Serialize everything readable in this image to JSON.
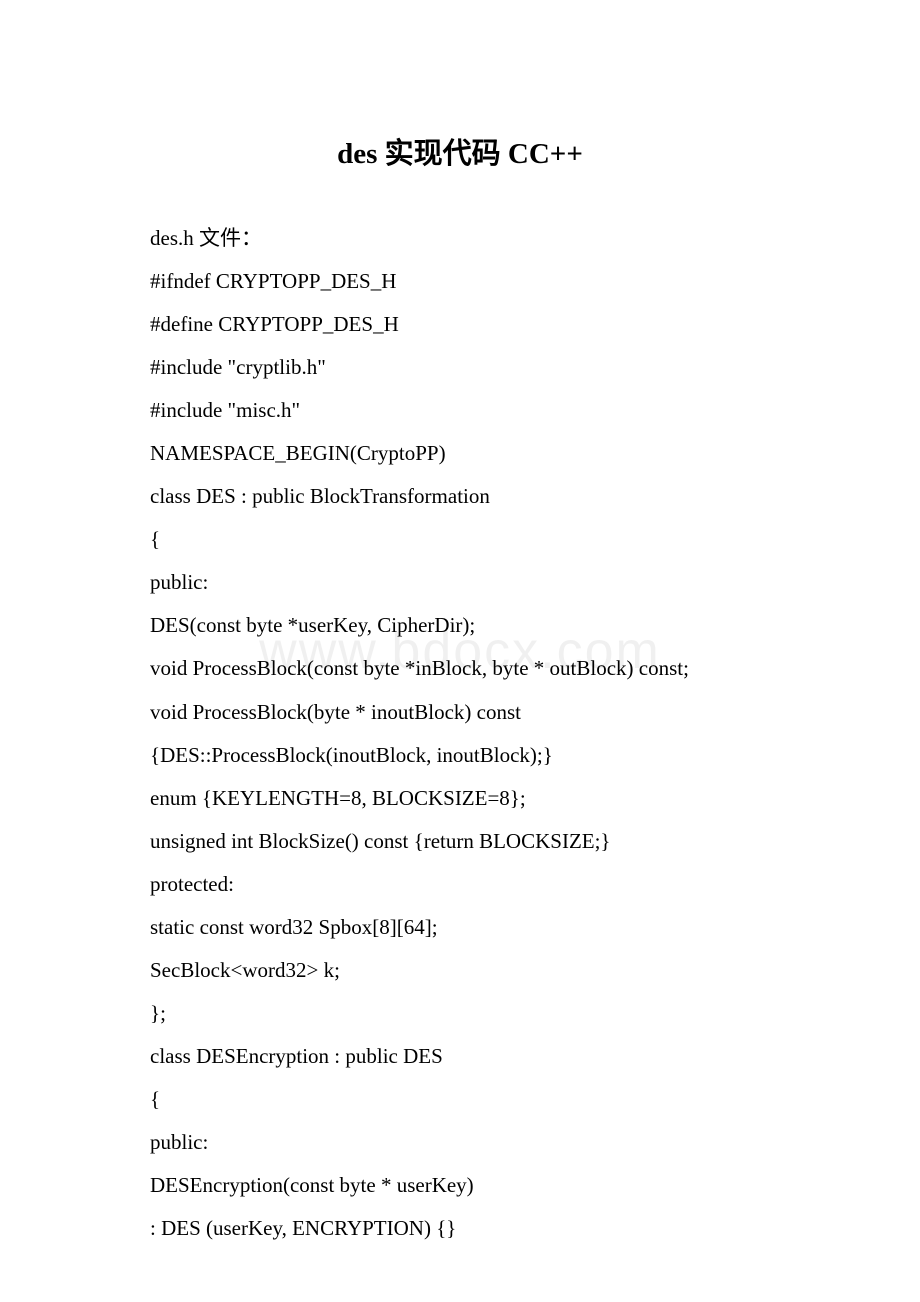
{
  "title": "des 实现代码 CC++",
  "watermark": "www.bdocx.com",
  "lines": [
    "des.h 文件：",
    "#ifndef CRYPTOPP_DES_H",
    "#define CRYPTOPP_DES_H",
    "#include \"cryptlib.h\"",
    "#include \"misc.h\"",
    "NAMESPACE_BEGIN(CryptoPP)",
    "class DES : public BlockTransformation",
    "{",
    "public:",
    "DES(const byte *userKey, CipherDir);",
    "void ProcessBlock(const byte *inBlock, byte * outBlock) const;",
    "void ProcessBlock(byte * inoutBlock) const",
    "{DES::ProcessBlock(inoutBlock, inoutBlock);}",
    "enum {KEYLENGTH=8, BLOCKSIZE=8};",
    "unsigned int BlockSize() const {return BLOCKSIZE;}",
    "protected:",
    "static const word32 Spbox[8][64];",
    "SecBlock<word32> k;",
    "};",
    "class DESEncryption : public DES",
    "{",
    "public:",
    "DESEncryption(const byte * userKey)",
    ": DES (userKey, ENCRYPTION) {}"
  ]
}
